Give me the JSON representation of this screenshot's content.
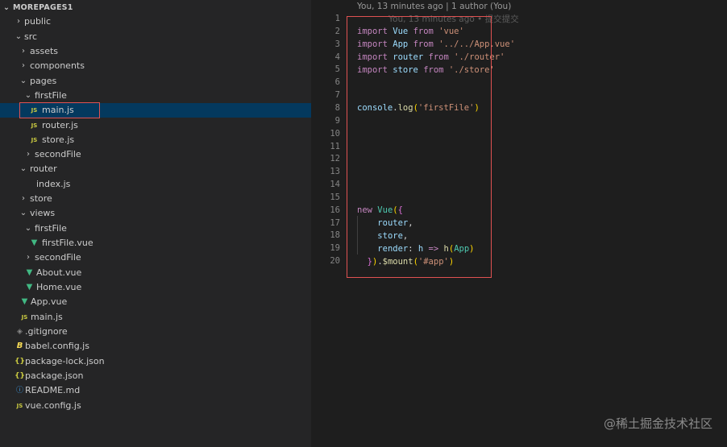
{
  "explorer": {
    "title": "MOREPAGES1",
    "rows": [
      {
        "label": "public",
        "icon": "folder"
      },
      {
        "label": "src",
        "icon": "folder"
      },
      {
        "label": "assets",
        "icon": "folder"
      },
      {
        "label": "components",
        "icon": "folder"
      },
      {
        "label": "pages",
        "icon": "folder"
      },
      {
        "label": "firstFile",
        "icon": "folder"
      },
      {
        "label": "main.js",
        "icon": "js",
        "icon_text": "JS"
      },
      {
        "label": "router.js",
        "icon": "js",
        "icon_text": "JS"
      },
      {
        "label": "store.js",
        "icon": "js",
        "icon_text": "JS"
      },
      {
        "label": "secondFile",
        "icon": "folder"
      },
      {
        "label": "router",
        "icon": "folder"
      },
      {
        "label": "index.js",
        "icon": "js",
        "icon_text": "JS"
      },
      {
        "label": "store",
        "icon": "folder"
      },
      {
        "label": "views",
        "icon": "folder"
      },
      {
        "label": "firstFile",
        "icon": "folder"
      },
      {
        "label": "firstFile.vue",
        "icon": "vue"
      },
      {
        "label": "secondFile",
        "icon": "folder"
      },
      {
        "label": "About.vue",
        "icon": "vue"
      },
      {
        "label": "Home.vue",
        "icon": "vue"
      },
      {
        "label": "App.vue",
        "icon": "vue"
      },
      {
        "label": "main.js",
        "icon": "js",
        "icon_text": "JS"
      },
      {
        "label": ".gitignore",
        "icon": "git"
      },
      {
        "label": "babel.config.js",
        "icon": "babel",
        "icon_text": "B"
      },
      {
        "label": "package-lock.json",
        "icon": "json",
        "icon_text": "{}"
      },
      {
        "label": "package.json",
        "icon": "json",
        "icon_text": "{}"
      },
      {
        "label": "README.md",
        "icon": "info"
      },
      {
        "label": "vue.config.js",
        "icon": "js",
        "icon_text": "JS"
      }
    ]
  },
  "editor": {
    "codelens": "You, 13 minutes ago | 1 author (You)",
    "inline_blame": "You, 13 minutes ago • 提交提交",
    "line_numbers": [
      "1",
      "2",
      "3",
      "4",
      "5",
      "6",
      "7",
      "8",
      "9",
      "10",
      "11",
      "12",
      "13",
      "14",
      "15",
      "16",
      "17",
      "18",
      "19",
      "20"
    ],
    "code": {
      "l2": [
        "import",
        "Vue",
        "from",
        "'vue'"
      ],
      "l3": [
        "import",
        "App",
        "from",
        "'../../App.vue'"
      ],
      "l4": [
        "import",
        "router",
        "from",
        "'./router'"
      ],
      "l5": [
        "import",
        "store",
        "from",
        "'./store'"
      ],
      "l8": [
        "console",
        ".",
        "log",
        "(",
        "'firstFile'",
        ")"
      ],
      "l16": [
        "new",
        "Vue",
        "(",
        "{"
      ],
      "l17": [
        "router",
        ","
      ],
      "l18": [
        "store",
        ","
      ],
      "l19": [
        "render",
        ":",
        "h",
        "=>",
        "h",
        "(",
        "App",
        ")"
      ],
      "l20": [
        "}",
        ")",
        ".",
        "$mount",
        "(",
        "'#app'",
        ")"
      ]
    }
  },
  "watermark": "@稀土掘金技术社区",
  "colors": {
    "sidebar_bg": "#252526",
    "editor_bg": "#1e1e1e",
    "selected_row": "#04395e",
    "highlight_border": "#e05252",
    "keyword": "#c586c0",
    "string": "#ce9178"
  }
}
